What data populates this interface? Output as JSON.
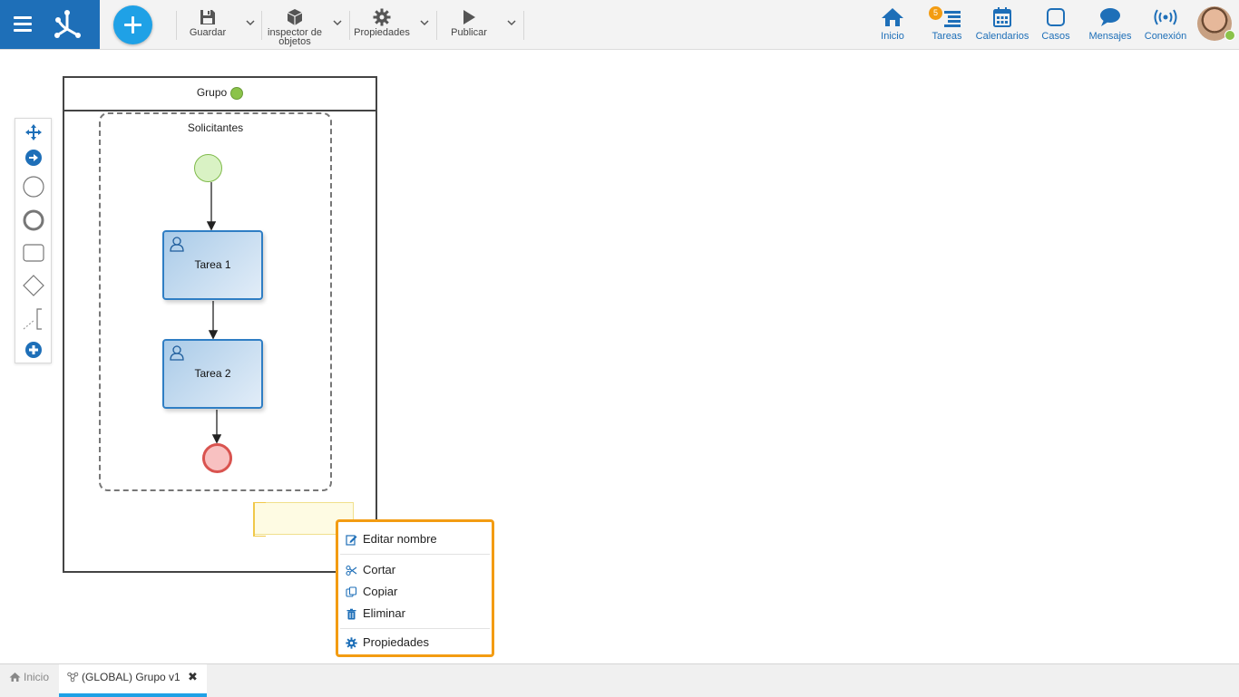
{
  "toolbar": {
    "save_label": "Guardar",
    "inspector_label_line1": "inspector de",
    "inspector_label_line2": "objetos",
    "properties_label": "Propiedades",
    "publish_label": "Publicar"
  },
  "nav": {
    "home_label": "Inicio",
    "tasks_label": "Tareas",
    "tasks_badge": "5",
    "calendars_label": "Calendarios",
    "cases_label": "Casos",
    "messages_label": "Mensajes",
    "connection_label": "Conexión"
  },
  "diagram": {
    "pool_title": "Grupo",
    "lane_title": "Solicitantes",
    "task1_label": "Tarea 1",
    "task2_label": "Tarea 2"
  },
  "context_menu": {
    "edit_name": "Editar nombre",
    "cut": "Cortar",
    "copy": "Copiar",
    "delete": "Eliminar",
    "properties": "Propiedades"
  },
  "tabs": {
    "home_label": "Inicio",
    "active_label": "(GLOBAL) Grupo v1"
  },
  "colors": {
    "brand_blue": "#1e6fb8",
    "add_button": "#1fa1e6",
    "highlight_orange": "#f39c12",
    "status_green": "#8bc34a",
    "end_event_red": "#d9534f"
  }
}
